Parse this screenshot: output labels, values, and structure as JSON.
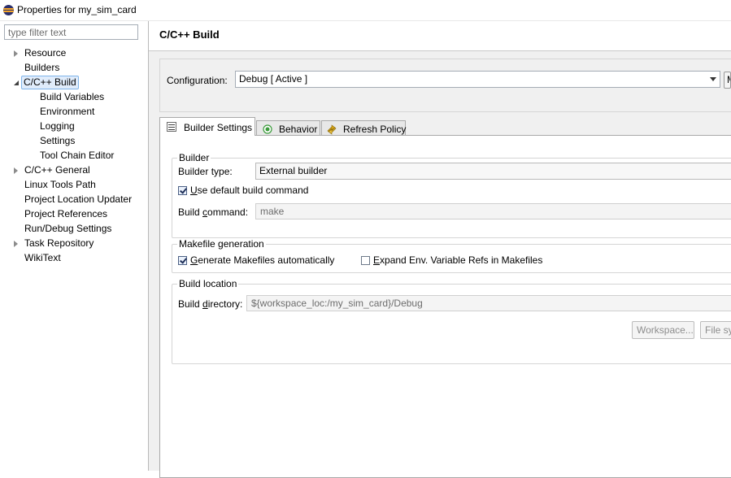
{
  "window": {
    "title": "Properties for my_sim_card"
  },
  "filter": {
    "placeholder": "type filter text"
  },
  "tree": {
    "resource": "Resource",
    "builders": "Builders",
    "cc_build": "C/C++ Build",
    "build_variables": "Build Variables",
    "environment": "Environment",
    "logging": "Logging",
    "settings": "Settings",
    "tool_chain_editor": "Tool Chain Editor",
    "cc_general": "C/C++ General",
    "linux_tools_path": "Linux Tools Path",
    "project_location_updater": "Project Location Updater",
    "project_references": "Project References",
    "run_debug_settings": "Run/Debug Settings",
    "task_repository": "Task Repository",
    "wikitext": "WikiText"
  },
  "page": {
    "title": "C/C++ Build"
  },
  "config": {
    "label": "Configuration:",
    "value": "Debug  [ Active ]",
    "manage_label": "M"
  },
  "tabs": {
    "builder_settings": "Builder Settings",
    "behavior": "Behavior",
    "refresh_policy": "Refresh Policy"
  },
  "builder": {
    "group_title": "Builder",
    "type_label": "Builder type:",
    "type_value": "External builder",
    "use_default_pre": "",
    "use_default_ul": "U",
    "use_default_post": "se default build command",
    "use_default_checked": true,
    "command_label_pre": "Build ",
    "command_label_ul": "c",
    "command_label_post": "ommand:",
    "command_value": "make"
  },
  "makefile": {
    "group_title": "Makefile generation",
    "generate_ul": "G",
    "generate_post": "enerate Makefiles automatically",
    "generate_checked": true,
    "expand_ul": "E",
    "expand_post": "xpand Env. Variable Refs in Makefiles",
    "expand_checked": false
  },
  "location": {
    "group_title": "Build location",
    "dir_label_pre": "Build ",
    "dir_label_ul": "d",
    "dir_label_post": "irectory:",
    "dir_value": "${workspace_loc:/my_sim_card}/Debug",
    "workspace_button": "Workspace...",
    "filesystem_button": "File sys"
  },
  "colors": {
    "selection_bg": "#e0ecfb",
    "selection_border": "#7eb4ea",
    "behavior_icon": "#3a9b3a",
    "refresh_icon": "#d9a515"
  },
  "icons": {
    "builder_settings": "list-icon",
    "behavior": "radio-dot-icon",
    "refresh_policy": "refresh-arrows-icon"
  }
}
